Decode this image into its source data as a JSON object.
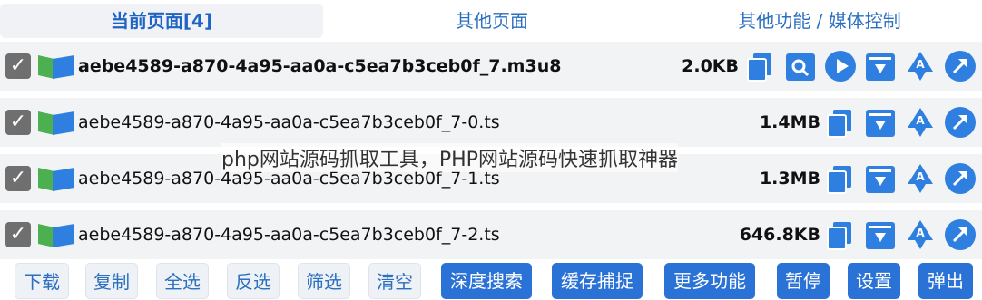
{
  "tabs": [
    {
      "label": "当前页面[4]"
    },
    {
      "label": "其他页面"
    },
    {
      "label": "其他功能 / 媒体控制"
    }
  ],
  "rows": [
    {
      "name": "aebe4589-a870-4a95-aa0a-c5ea7b3ceb0f_7.m3u8",
      "size": "2.0KB",
      "checked": true
    },
    {
      "name": "aebe4589-a870-4a95-aa0a-c5ea7b3ceb0f_7-0.ts",
      "size": "1.4MB",
      "checked": true
    },
    {
      "name": "aebe4589-a870-4a95-aa0a-c5ea7b3ceb0f_7-1.ts",
      "size": "1.3MB",
      "checked": true
    },
    {
      "name": "aebe4589-a870-4a95-aa0a-c5ea7b3ceb0f_7-2.ts",
      "size": "646.8KB",
      "checked": true
    }
  ],
  "watermark": "php网站源码抓取工具，PHP网站源码快速抓取神器",
  "bottom_buttons": [
    {
      "label": "下载"
    },
    {
      "label": "复制"
    },
    {
      "label": "全选"
    },
    {
      "label": "反选"
    },
    {
      "label": "筛选"
    },
    {
      "label": "清空"
    },
    {
      "label": "深度搜索"
    },
    {
      "label": "缓存捕捉"
    },
    {
      "label": "更多功能"
    },
    {
      "label": "暂停"
    },
    {
      "label": "设置"
    },
    {
      "label": "弹出"
    }
  ],
  "icons": {
    "checkbox": "checkmark-icon",
    "file": "file-flag-icon",
    "copy": "copy-icon",
    "search": "search-icon",
    "play": "play-icon",
    "download": "download-icon",
    "send": "send-arrow-icon",
    "open": "open-arrow-icon"
  },
  "colors": {
    "accent": "#2a72d6",
    "icon_blue": "#2f7fe0"
  }
}
